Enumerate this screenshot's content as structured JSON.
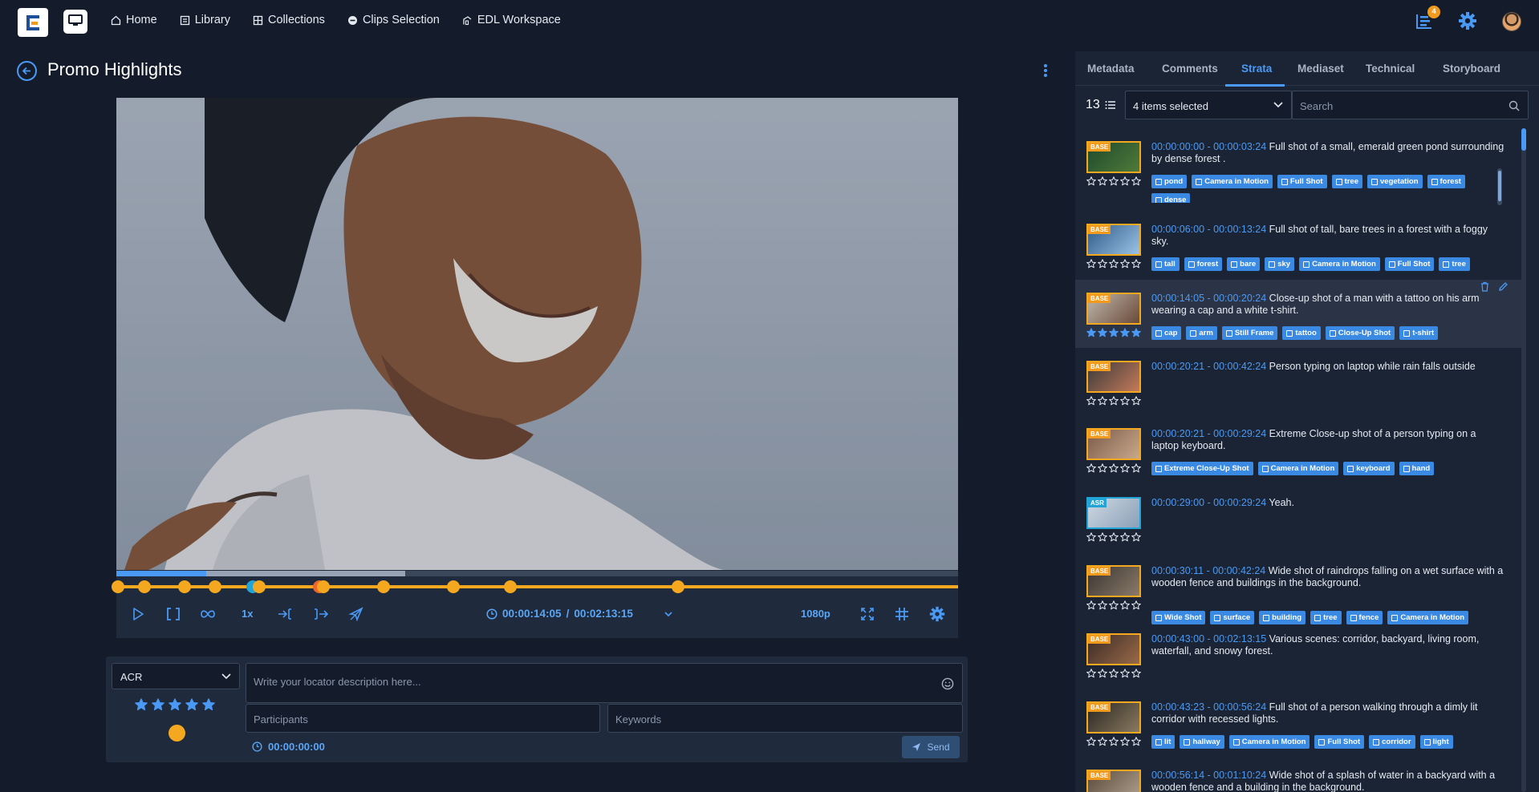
{
  "nav": {
    "items": [
      {
        "label": "Home",
        "icon": "home-icon"
      },
      {
        "label": "Library",
        "icon": "library-icon"
      },
      {
        "label": "Collections",
        "icon": "grid-icon"
      },
      {
        "label": "Clips Selection",
        "icon": "clips-icon"
      },
      {
        "label": "EDL Workspace",
        "icon": "edl-icon"
      }
    ],
    "notification_count": "4"
  },
  "page": {
    "title": "Promo Highlights"
  },
  "player": {
    "speed": "1x",
    "current_time": "00:00:14:05",
    "separator": "/",
    "duration": "00:02:13:15",
    "quality": "1080p",
    "played_fraction": 0.107,
    "buffered_fraction": 0.343,
    "marker_positions_seconds": [
      0.2,
      4.5,
      10.8,
      15.7,
      21.6,
      22.7,
      32.2,
      32.9,
      42.4,
      53.5,
      62.5,
      89.1
    ],
    "marker_kinds": [
      "orange",
      "orange",
      "orange",
      "orange",
      "blue",
      "orange",
      "red",
      "orange",
      "orange",
      "orange",
      "orange",
      "orange"
    ]
  },
  "locator": {
    "category": "ACR",
    "description_placeholder": "Write your locator description here...",
    "participants_placeholder": "Participants",
    "keywords_placeholder": "Keywords",
    "time": "00:00:00:00",
    "send_label": "Send",
    "rating": 5,
    "marker_color": "#f4a81f"
  },
  "panel": {
    "tabs": [
      "Metadata",
      "Comments",
      "Strata",
      "Mediaset",
      "Technical",
      "Storyboard"
    ],
    "active_tab": "Strata",
    "count": "13",
    "selection": "4 items selected",
    "search_placeholder": "Search",
    "items": [
      {
        "type": "BASE",
        "time": "00:00:00:00 - 00:00:03:24",
        "text": "Full shot of a small, emerald green pond surrounding by dense forest .",
        "tags": [
          "pond",
          "Camera in Motion",
          "Full Shot",
          "tree",
          "vegetation",
          "forest",
          "dense"
        ],
        "rating": 0
      },
      {
        "type": "BASE",
        "time": "00:00:06:00 - 00:00:13:24",
        "text": "Full shot of tall, bare trees in a forest with a foggy sky.",
        "tags": [
          "tall",
          "forest",
          "bare",
          "sky",
          "Camera in Motion",
          "Full Shot",
          "tree"
        ],
        "rating": 0
      },
      {
        "type": "BASE",
        "time": "00:00:14:05 - 00:00:20:24",
        "text": "Close-up shot of a man with a tattoo on his arm wearing a cap and a white t-shirt.",
        "tags": [
          "cap",
          "arm",
          "Still Frame",
          "tattoo",
          "Close-Up Shot",
          "t-shirt"
        ],
        "rating": 5
      },
      {
        "type": "BASE",
        "time": "00:00:20:21 - 00:00:42:24",
        "text": "Person typing on laptop while rain falls outside",
        "tags": [],
        "rating": 0
      },
      {
        "type": "BASE",
        "time": "00:00:20:21 - 00:00:29:24",
        "text": "Extreme Close-up shot of a person typing on a laptop keyboard.",
        "tags": [
          "Extreme Close-Up Shot",
          "Camera in Motion",
          "keyboard",
          "hand"
        ],
        "rating": 0
      },
      {
        "type": "ASR",
        "time": "00:00:29:00 - 00:00:29:24",
        "text": "Yeah.",
        "tags": [],
        "rating": 0
      },
      {
        "type": "BASE",
        "time": "00:00:30:11 - 00:00:42:24",
        "text": "Wide shot of raindrops falling on a wet surface with a wooden fence and buildings in the background.",
        "tags": [
          "Wide Shot",
          "surface",
          "building",
          "tree",
          "fence",
          "Camera in Motion"
        ],
        "rating": 0
      },
      {
        "type": "BASE",
        "time": "00:00:43:00 - 00:02:13:15",
        "text": "Various scenes: corridor, backyard, living room, waterfall, and snowy forest.",
        "tags": [],
        "rating": 0
      },
      {
        "type": "BASE",
        "time": "00:00:43:23 - 00:00:56:24",
        "text": "Full shot of a person walking through a dimly lit corridor with recessed lights.",
        "tags": [
          "lit",
          "hallway",
          "Camera in Motion",
          "Full Shot",
          "corridor",
          "light"
        ],
        "rating": 0
      },
      {
        "type": "BASE",
        "time": "00:00:56:14 - 00:01:10:24",
        "text": "Wide shot of a splash of water in a backyard with a wooden fence and a building in the background.",
        "tags": [],
        "rating": 0
      }
    ]
  },
  "colors": {
    "accent": "#4a9af5",
    "marker": "#f4a81f",
    "asr": "#22a4d6",
    "tag": "#3a8ae4"
  }
}
